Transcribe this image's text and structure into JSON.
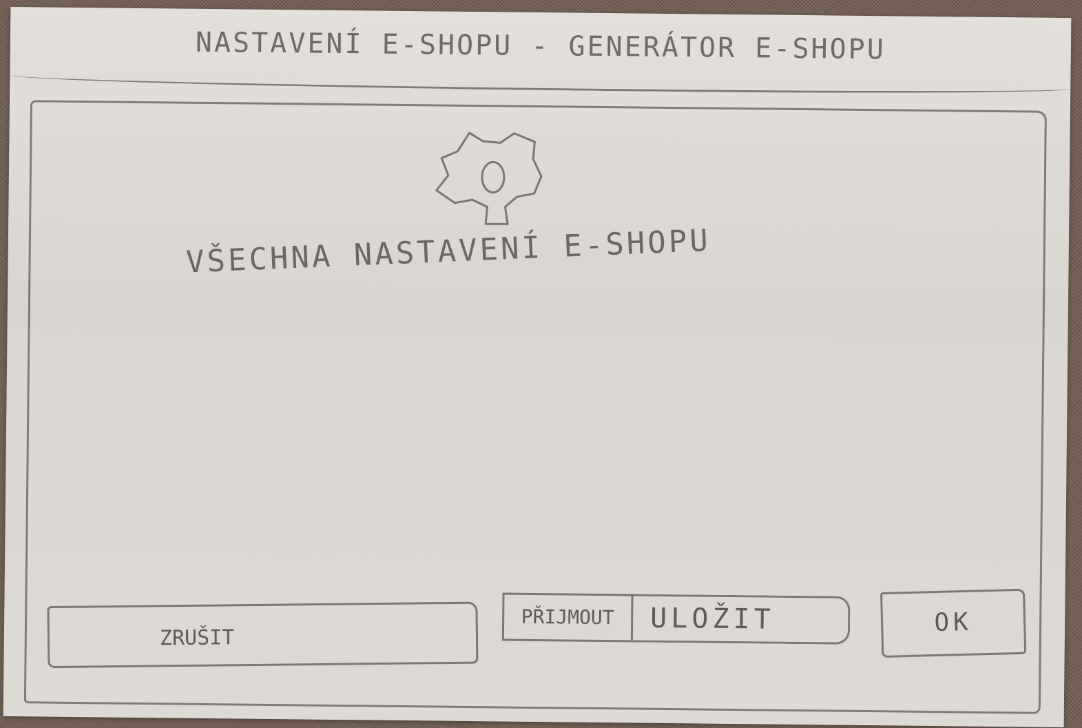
{
  "window": {
    "title": "NASTAVENÍ E-SHOPU - GENERÁTOR E-SHOPU"
  },
  "main": {
    "icon": "gear-icon",
    "heading": "VŠECHNA NASTAVENÍ E-SHOPU"
  },
  "buttons": {
    "cancel": "ZRUŠIT",
    "apply": "PŘIJMOUT",
    "save": "ULOŽIT",
    "ok": "OK"
  }
}
